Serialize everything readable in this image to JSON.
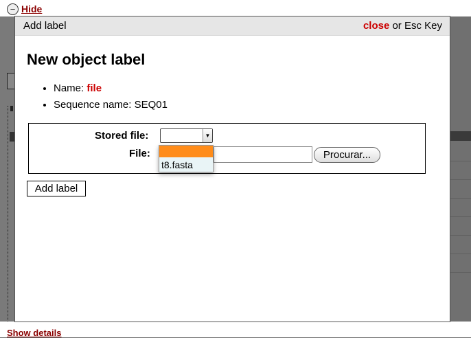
{
  "background": {
    "hide_label": "Hide",
    "show_details_label": "Show details"
  },
  "modal": {
    "title": "Add label",
    "close_label": "close",
    "close_suffix": "or Esc Key",
    "heading": "New object label",
    "info": {
      "name_label": "Name:",
      "name_value": "file",
      "sequence_label": "Sequence name:",
      "sequence_value": "SEQ01"
    },
    "form": {
      "stored_file_label": "Stored file:",
      "stored_file_value": "",
      "stored_file_options": [
        "",
        "t8.fasta"
      ],
      "file_label": "File:",
      "file_value": "",
      "browse_label": "Procurar..."
    },
    "submit_label": "Add label"
  },
  "colors": {
    "accent_red": "#cc0000",
    "dark_red": "#8b0000",
    "highlight_orange": "#ff8c1a",
    "overlay": "#6b6b6b"
  }
}
